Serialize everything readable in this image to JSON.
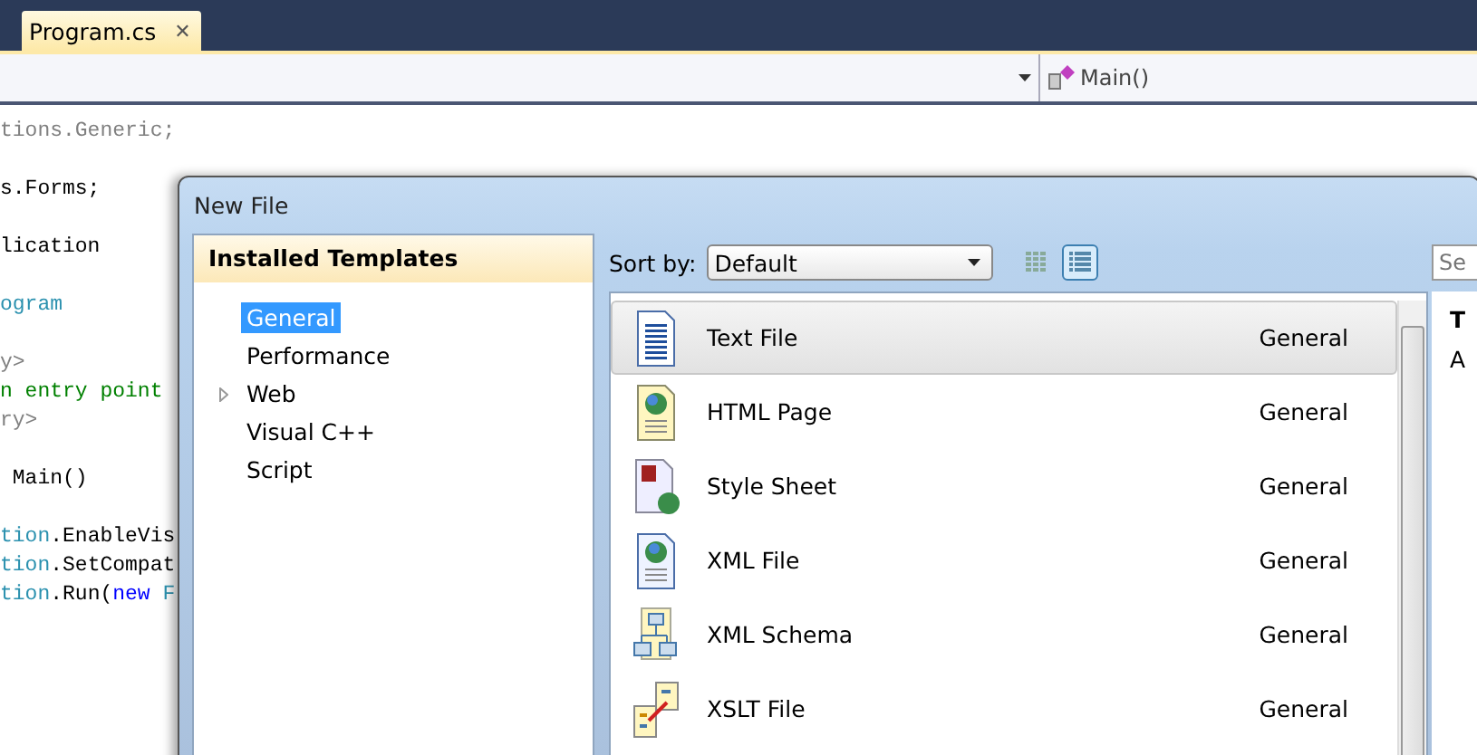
{
  "tab": {
    "label": "Program.cs",
    "close": "✕",
    "selected": true
  },
  "navbar": {
    "member": "Main()"
  },
  "code_lines": [
    {
      "kind": "code",
      "tokens": [
        {
          "text": "tions.Generic;",
          "kind": "faded"
        }
      ]
    },
    {
      "kind": "blank"
    },
    {
      "kind": "code",
      "tokens": [
        {
          "text": "s.Forms;",
          "kind": "plain"
        }
      ]
    },
    {
      "kind": "blank"
    },
    {
      "kind": "code",
      "tokens": [
        {
          "text": "lication",
          "kind": "plain"
        }
      ]
    },
    {
      "kind": "blank"
    },
    {
      "kind": "code",
      "tokens": [
        {
          "text": "ogram",
          "kind": "type"
        }
      ]
    },
    {
      "kind": "blank"
    },
    {
      "kind": "code",
      "tokens": [
        {
          "text": "y>",
          "kind": "faded"
        }
      ]
    },
    {
      "kind": "code",
      "tokens": [
        {
          "text": "n entry point",
          "kind": "comment"
        }
      ]
    },
    {
      "kind": "code",
      "tokens": [
        {
          "text": "ry>",
          "kind": "faded"
        }
      ]
    },
    {
      "kind": "blank"
    },
    {
      "kind": "code",
      "tokens": [
        {
          "text": " Main()",
          "kind": "plain"
        }
      ]
    },
    {
      "kind": "blank"
    },
    {
      "kind": "code",
      "tokens": [
        {
          "text": "tion",
          "kind": "type"
        },
        {
          "text": ".EnableVis",
          "kind": "plain"
        }
      ]
    },
    {
      "kind": "code",
      "tokens": [
        {
          "text": "tion",
          "kind": "type"
        },
        {
          "text": ".SetCompat",
          "kind": "plain"
        }
      ]
    },
    {
      "kind": "code",
      "tokens": [
        {
          "text": "tion",
          "kind": "type"
        },
        {
          "text": ".Run(",
          "kind": "plain"
        },
        {
          "text": "new",
          "kind": "keyword"
        },
        {
          "text": " F",
          "kind": "type"
        }
      ]
    }
  ],
  "dialog": {
    "title": "New File",
    "categories_header": "Installed Templates",
    "categories": [
      {
        "label": "General",
        "selected": true,
        "expandable": false
      },
      {
        "label": "Performance",
        "selected": false,
        "expandable": false
      },
      {
        "label": "Web",
        "selected": false,
        "expandable": true
      },
      {
        "label": "Visual C++",
        "selected": false,
        "expandable": false
      },
      {
        "label": "Script",
        "selected": false,
        "expandable": false
      }
    ],
    "sort": {
      "label": "Sort by:",
      "value": "Default"
    },
    "view_buttons": [
      {
        "kind": "grid",
        "selected": false
      },
      {
        "kind": "list",
        "selected": true
      }
    ],
    "search": {
      "placeholder": "Se"
    },
    "templates": [
      {
        "kind": "text",
        "name": "Text File",
        "category": "General",
        "selected": true
      },
      {
        "kind": "html",
        "name": "HTML Page",
        "category": "General",
        "selected": false
      },
      {
        "kind": "css",
        "name": "Style Sheet",
        "category": "General",
        "selected": false
      },
      {
        "kind": "xml",
        "name": "XML File",
        "category": "General",
        "selected": false
      },
      {
        "kind": "schema",
        "name": "XML Schema",
        "category": "General",
        "selected": false
      },
      {
        "kind": "xslt",
        "name": "XSLT File",
        "category": "General",
        "selected": false
      }
    ],
    "details": {
      "title": "T",
      "description": "A"
    }
  }
}
